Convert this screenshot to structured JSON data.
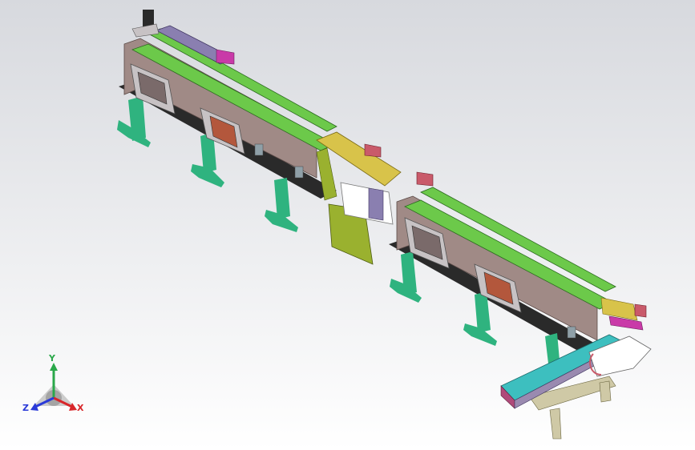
{
  "viewport": {
    "background_top": "#d7d9de",
    "background_bottom": "#ffffff"
  },
  "model": {
    "description_icon": "conveyor-assembly-icon",
    "colors": {
      "frame_plate": "#a08a86",
      "leg": "#2fb37f",
      "base_plate": "#2a2a2a",
      "rail": "#6cc94a",
      "top_rail": "#8a7fb0",
      "bracket": "#9ab12f",
      "magenta": "#c93aa8",
      "outlet_belt": "#3dbfbf",
      "outlet_frame": "#b04a7a",
      "stand": "#cfc9a6"
    }
  },
  "triad": {
    "y_label": "Y",
    "x_label": "X",
    "z_label": "Z",
    "y_color": "#2aa84a",
    "x_color": "#d8262a",
    "z_color": "#2a3ad8"
  }
}
